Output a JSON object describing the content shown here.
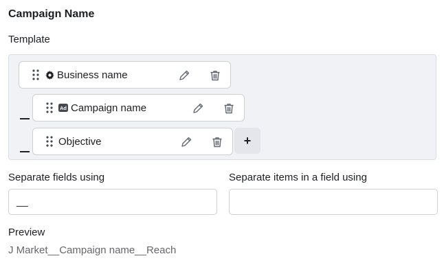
{
  "section": {
    "title": "Campaign Name",
    "template_label": "Template"
  },
  "template": {
    "items": [
      {
        "label": "Business name",
        "icon": "gear-icon"
      },
      {
        "label": "Campaign name",
        "icon": "ad-badge-icon"
      },
      {
        "label": "Objective",
        "icon": ""
      }
    ],
    "separator_glyph": "—",
    "add_button": "+"
  },
  "fields": {
    "separate_fields_label": "Separate fields using",
    "separate_fields_value": "__",
    "separate_items_label": "Separate items in a field using",
    "separate_items_value": ""
  },
  "preview": {
    "label": "Preview",
    "value": "J Market__Campaign name__Reach"
  }
}
